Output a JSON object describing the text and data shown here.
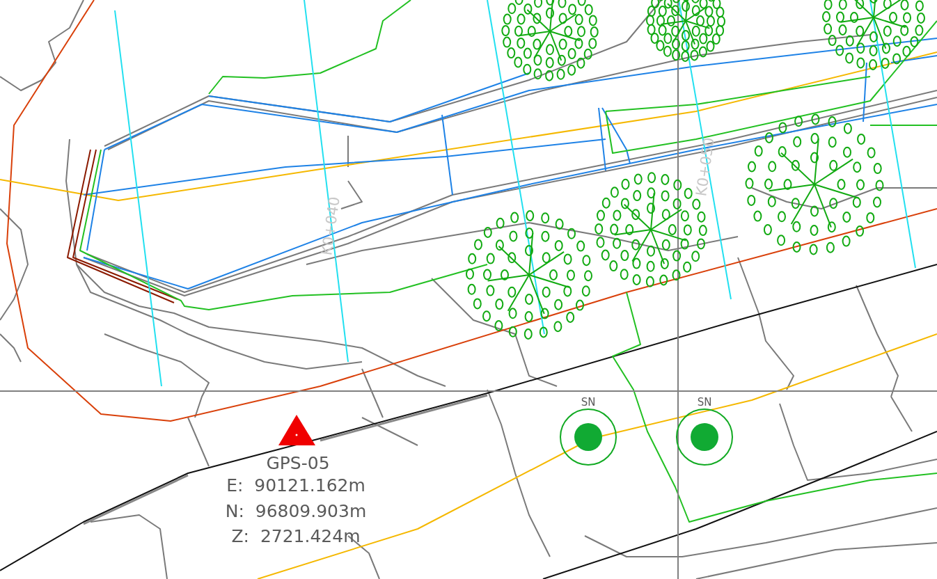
{
  "station_labels": [
    {
      "text": "K0+040"
    },
    {
      "text": "K0+050"
    }
  ],
  "markers": [
    {
      "label": "SN"
    },
    {
      "label": "SN"
    }
  ],
  "gps_point": {
    "name": "GPS-05",
    "lines": [
      "E:  90121.162m",
      "N:  96809.903m",
      "Z:  2721.424m"
    ]
  }
}
